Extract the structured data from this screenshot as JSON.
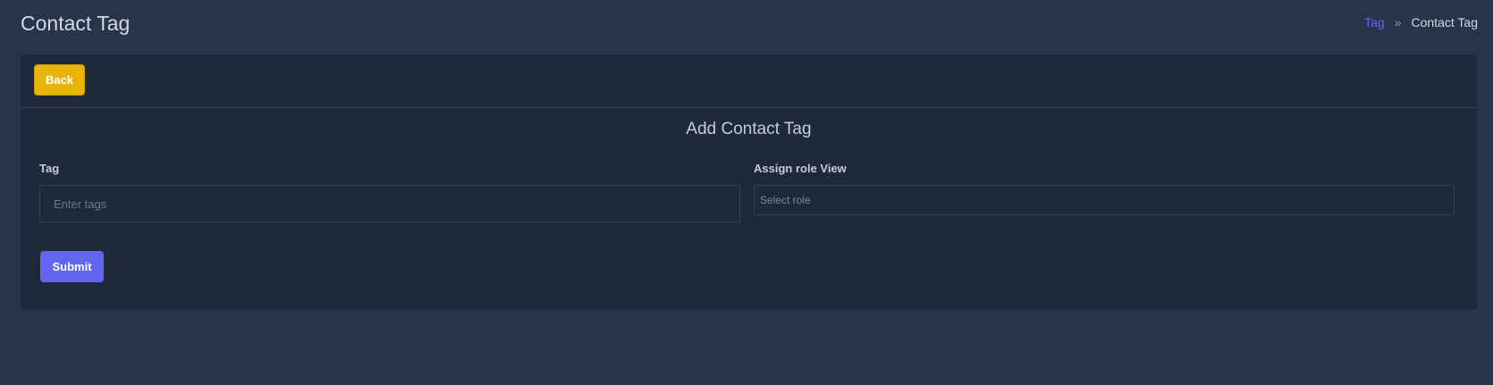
{
  "header": {
    "title": "Contact Tag",
    "breadcrumb": {
      "link": "Tag",
      "separator": "»",
      "current": "Contact Tag"
    }
  },
  "toolbar": {
    "back_label": "Back"
  },
  "form": {
    "title": "Add Contact Tag",
    "tag_label": "Tag",
    "tag_placeholder": "Enter tags",
    "tag_value": "",
    "role_label": "Assign role View",
    "role_placeholder": "Select role",
    "submit_label": "Submit"
  },
  "colors": {
    "background": "#273449",
    "card": "#1e293b",
    "accent": "#6366f1",
    "warning": "#eab308"
  }
}
